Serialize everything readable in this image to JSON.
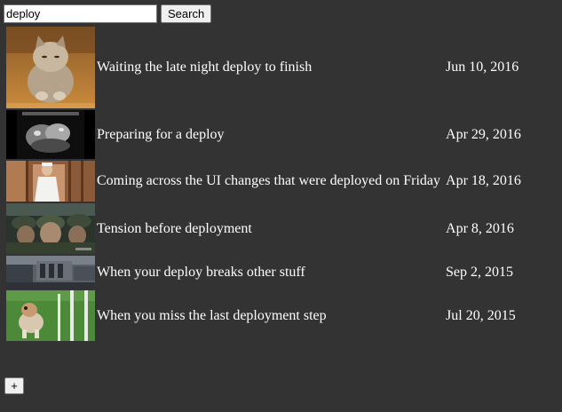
{
  "search": {
    "value": "deploy",
    "button_label": "Search"
  },
  "results": [
    {
      "title": "Waiting the late night deploy to finish",
      "date": "Jun 10, 2016",
      "thumbnail": "kitten-falling-asleep-thumbnail"
    },
    {
      "title": "Preparing for a deploy",
      "date": "Apr 29, 2016",
      "thumbnail": "black-and-white-dogs-thumbnail"
    },
    {
      "title": "Coming across the UI changes that were deployed on Friday",
      "date": "Apr 18, 2016",
      "thumbnail": "man-in-white-robe-thumbnail"
    },
    {
      "title": "Tension before deployment",
      "date": "Apr 8, 2016",
      "thumbnail": "soldiers-in-boat-thumbnail"
    },
    {
      "title": "When your deploy breaks other stuff",
      "date": "Sep 2, 2015",
      "thumbnail": "truck-crash-thumbnail"
    },
    {
      "title": "When you miss the last deployment step",
      "date": "Jul 20, 2015",
      "thumbnail": "dog-agility-poles-thumbnail"
    }
  ],
  "add_button_label": "+"
}
